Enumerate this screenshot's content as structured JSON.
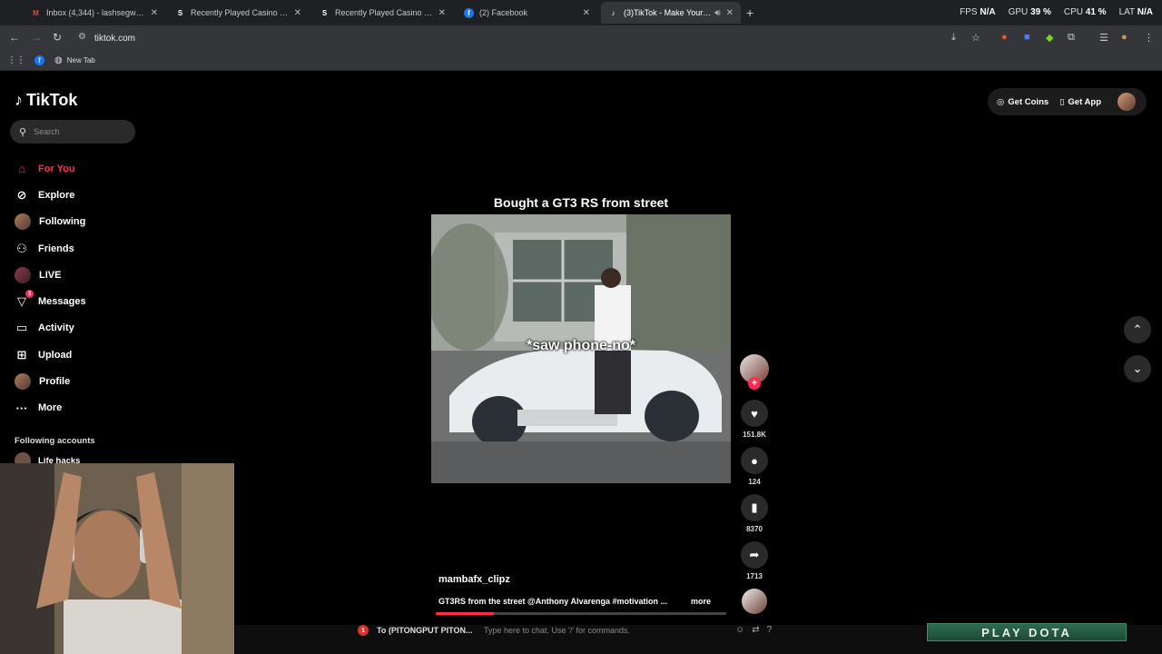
{
  "browser": {
    "tabs": [
      {
        "title": "Inbox (4,344) - lashsegway@gm",
        "icon": "gmail-icon",
        "active": false
      },
      {
        "title": "Recently Played Casino Games",
        "icon": "stake-icon",
        "active": false
      },
      {
        "title": "Recently Played Casino Games",
        "icon": "stake-icon",
        "active": false
      },
      {
        "title": "(2) Facebook",
        "icon": "facebook-icon",
        "active": false
      },
      {
        "title": "(3)TikTok - Make Your Day",
        "icon": "tiktok-icon",
        "active": true
      }
    ],
    "url": "tiktok.com",
    "bookmarks": [
      {
        "label": ""
      },
      {
        "label": "New Tab"
      }
    ],
    "stats": {
      "fps_label": "FPS",
      "fps_value": "N/A",
      "gpu_label": "GPU",
      "gpu_value": "39 %",
      "cpu_label": "CPU",
      "cpu_value": "41 %",
      "lat_label": "LAT",
      "lat_value": "N/A"
    }
  },
  "tiktok": {
    "logo": "TikTok",
    "search_placeholder": "Search",
    "nav": [
      {
        "label": "For You",
        "icon": "home-icon",
        "active": true
      },
      {
        "label": "Explore",
        "icon": "compass-icon"
      },
      {
        "label": "Following",
        "icon": "avatar-icon"
      },
      {
        "label": "Friends",
        "icon": "friends-icon"
      },
      {
        "label": "LIVE",
        "icon": "live-icon"
      },
      {
        "label": "Messages",
        "icon": "messages-icon",
        "badge": "3"
      },
      {
        "label": "Activity",
        "icon": "activity-icon"
      },
      {
        "label": "Upload",
        "icon": "upload-icon"
      },
      {
        "label": "Profile",
        "icon": "profile-icon"
      },
      {
        "label": "More",
        "icon": "more-icon"
      }
    ],
    "following_title": "Following accounts",
    "following_accounts": [
      {
        "name": "Life hacks"
      }
    ],
    "top_right": {
      "get_coins": "Get Coins",
      "get_app": "Get App"
    },
    "video": {
      "title": "Bought a GT3 RS from street",
      "overlay_text": "*saw phone-no*",
      "username": "mambafx_clipz",
      "caption": "GT3RS from the street @Anthony Alvarenga #motivation ...",
      "more_label": "more",
      "progress": 0.2,
      "likes": "151.8K",
      "comments": "124",
      "saves": "8370",
      "shares": "1713"
    }
  },
  "chatbar": {
    "badge": "1",
    "recipient": "To (PITONGPUT PITON...",
    "input_placeholder": "Type here to chat. Use '/' for commands.",
    "banner": "PLAY DOTA"
  },
  "colors": {
    "accent": "#fe2c55",
    "background": "#000000"
  }
}
